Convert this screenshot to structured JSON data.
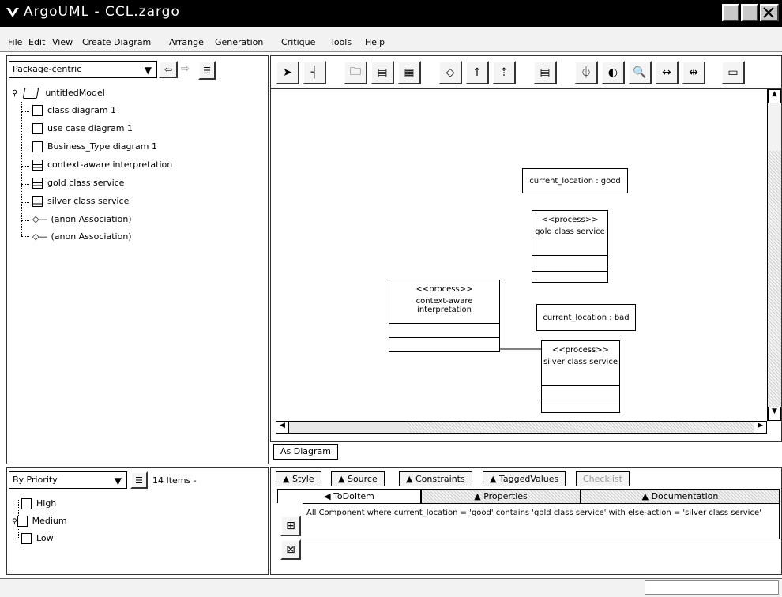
{
  "window": {
    "title": "ArgoUML - CCL.zargo"
  },
  "menu": [
    {
      "label": "File"
    },
    {
      "label": "Edit"
    },
    {
      "label": "View"
    },
    {
      "label": "Create Diagram"
    },
    {
      "label": "Arrange"
    },
    {
      "label": "Generation"
    },
    {
      "label": "Critique"
    },
    {
      "label": "Tools"
    },
    {
      "label": "Help"
    }
  ],
  "explorer": {
    "perspective": "Package-centric",
    "root": "untitledModel",
    "items": [
      {
        "label": "class diagram 1",
        "icon": "class-diagram-icon"
      },
      {
        "label": "use case diagram 1",
        "icon": "usecase-diagram-icon"
      },
      {
        "label": "Business_Type diagram 1",
        "icon": "document-icon"
      },
      {
        "label": "context-aware interpretation",
        "icon": "class-icon"
      },
      {
        "label": "gold class service",
        "icon": "class-icon"
      },
      {
        "label": "silver class service",
        "icon": "class-icon"
      },
      {
        "label": "(anon Association)",
        "icon": "association-icon"
      },
      {
        "label": "(anon Association)",
        "icon": "association-icon"
      }
    ]
  },
  "diagram": {
    "tab": "As Diagram",
    "notes": [
      {
        "text": "current_location : good"
      },
      {
        "text": "current_location : bad"
      }
    ],
    "classes": [
      {
        "stereotype": "<<process>>",
        "name": "gold class service"
      },
      {
        "stereotype": "<<process>>",
        "name": "context-aware interpretation"
      },
      {
        "stereotype": "<<process>>",
        "name": "silver class service"
      }
    ]
  },
  "todo": {
    "sort": "By Priority",
    "count": "14 Items -",
    "priorities": [
      "High",
      "Medium",
      "Low"
    ]
  },
  "details": {
    "tabs_top": [
      "Style",
      "Source",
      "Constraints",
      "TaggedValues",
      "Checklist"
    ],
    "tabs_bottom": [
      "ToDoItem",
      "Properties",
      "Documentation"
    ],
    "message": "All Component where current_location = 'good' contains 'gold class service' with else-action = 'silver class service'"
  }
}
